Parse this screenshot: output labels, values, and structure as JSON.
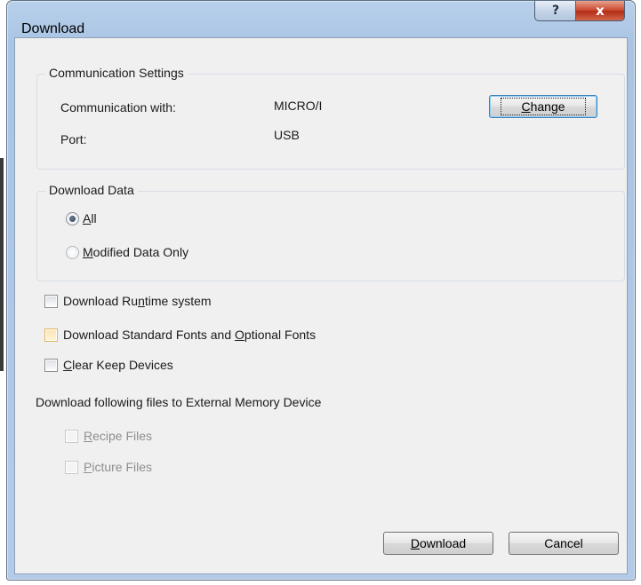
{
  "dialog": {
    "title": "Download",
    "help_glyph": "?",
    "close_glyph": "x"
  },
  "comm": {
    "legend": "Communication Settings",
    "comm_label": "Communication with:",
    "comm_value": "MICRO/I",
    "port_label": "Port:",
    "port_value": "USB",
    "change_button": {
      "pre": "",
      "mn": "C",
      "post": "hange"
    }
  },
  "download_data": {
    "legend": "Download Data",
    "all": {
      "pre": "",
      "mn": "A",
      "post": "ll",
      "selected": true
    },
    "modified": {
      "pre": "",
      "mn": "M",
      "post": "odified Data Only",
      "selected": false
    }
  },
  "options": {
    "runtime": {
      "pre": "Download Ru",
      "mn": "n",
      "post": "time system",
      "checked": false
    },
    "fonts": {
      "pre": "Download Standard Fonts and ",
      "mn": "O",
      "post": "ptional Fonts",
      "checked": false
    },
    "clear": {
      "pre": "",
      "mn": "C",
      "post": "lear Keep Devices",
      "checked": false
    }
  },
  "external": {
    "label": "Download following files to External Memory Device",
    "recipe": {
      "pre": "",
      "mn": "R",
      "post": "ecipe Files",
      "enabled": false
    },
    "picture": {
      "pre": "",
      "mn": "P",
      "post": "icture Files",
      "enabled": false
    }
  },
  "footer": {
    "download_button": {
      "pre": "",
      "mn": "D",
      "post": "ownload"
    },
    "cancel_button": "Cancel"
  }
}
